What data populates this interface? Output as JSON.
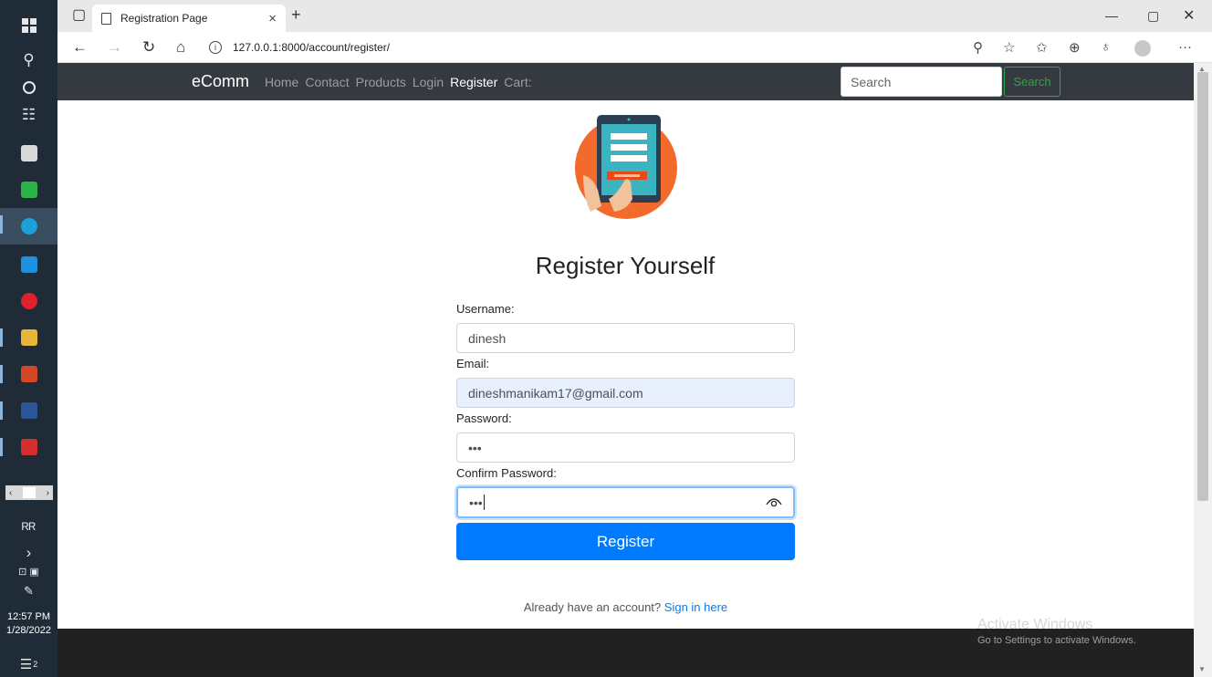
{
  "taskbar": {
    "clock_time": "12:57 PM",
    "clock_date": "1/28/2022",
    "notification_count": "2"
  },
  "browser": {
    "tab_title": "Registration Page",
    "url": "127.0.0.1:8000/account/register/"
  },
  "navbar": {
    "brand": "eComm",
    "links": [
      "Home",
      "Contact",
      "Products",
      "Login",
      "Register",
      "Cart:"
    ],
    "active_link": "Register",
    "search_placeholder": "Search",
    "search_button": "Search"
  },
  "form": {
    "heading": "Register Yourself",
    "username_label": "Username:",
    "username_value": "dinesh",
    "email_label": "Email:",
    "email_value": "dineshmanikam17@gmail.com",
    "password_label": "Password:",
    "password_value": "•••",
    "confirm_label": "Confirm Password:",
    "confirm_value": "•••",
    "submit_label": "Register",
    "signin_prompt": "Already have an account?",
    "signin_link": "Sign in here"
  },
  "watermark": {
    "line1": "Activate Windows",
    "line2": "Go to Settings to activate Windows."
  },
  "colors": {
    "navbar_bg": "#343a40",
    "primary": "#007bff",
    "success": "#28a745",
    "footer_bg": "#212121"
  },
  "icons": {
    "taskbar": [
      "windows-icon",
      "search-icon",
      "cortana-icon",
      "task-view-icon",
      "store-icon",
      "charts-icon",
      "edge-icon",
      "mail-icon",
      "opera-icon",
      "file-explorer-icon",
      "powerpoint-icon",
      "word-icon",
      "acrobat-icon"
    ],
    "browser": [
      "tab-actions-icon",
      "page-icon",
      "close-icon",
      "new-tab-icon",
      "back-icon",
      "forward-icon",
      "refresh-icon",
      "home-icon",
      "info-icon",
      "read-aloud-icon",
      "favorite-icon",
      "favorites-icon",
      "collections-icon",
      "extensions-icon",
      "profile-icon",
      "more-icon"
    ],
    "form": [
      "eye-icon"
    ]
  }
}
